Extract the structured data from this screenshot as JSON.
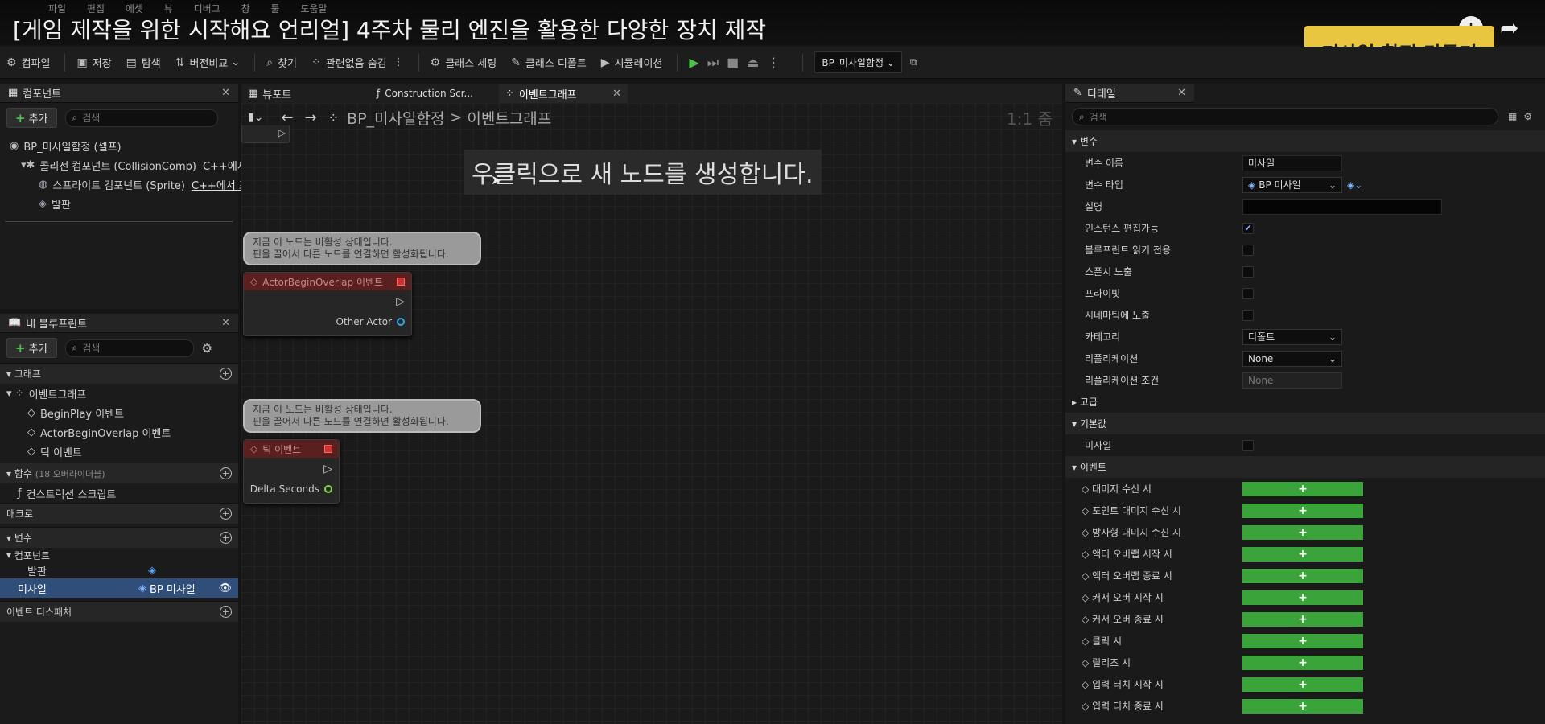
{
  "video": {
    "title": "[게임 제작을 위한 시작해요 언리얼] 4주차 물리 엔진을 활용한 다양한 장치 제작",
    "banner": "미사일 함정 만들기",
    "menu": [
      "파일",
      "편집",
      "에셋",
      "뷰",
      "디버그",
      "창",
      "툴",
      "도움말"
    ]
  },
  "toolbar": {
    "compile": "컴파일",
    "save": "저장",
    "browse": "탐색",
    "diff": "버전비교",
    "find": "찾기",
    "hide_unrelated": "관련없음 숨김",
    "class_settings": "클래스 세팅",
    "class_defaults": "클래스 디폴트",
    "simulation": "시뮬레이션",
    "bp_select": "BP_미사일함정"
  },
  "components_panel": {
    "tab": "컴포넌트",
    "add": "추가",
    "search_placeholder": "검색",
    "root": "BP_미사일함정 (셀프)",
    "items": [
      {
        "label": "콜리전 컴포넌트 (CollisionComp)",
        "note": "C++에서"
      },
      {
        "label": "스프라이트 컴포넌트 (Sprite)",
        "note": "C++에서 표"
      },
      {
        "label": "발판",
        "note": ""
      }
    ]
  },
  "my_blueprint": {
    "tab": "내 블루프린트",
    "add": "추가",
    "search_placeholder": "검색",
    "graph_header": "그래프",
    "event_graph": "이벤트그래프",
    "events": [
      "BeginPlay 이벤트",
      "ActorBeginOverlap 이벤트",
      "틱 이벤트"
    ],
    "functions_header": "함수",
    "functions_note": "(18 오버라이더블)",
    "construction_script": "컨스트럭션 스크립트",
    "macros_header": "매크로",
    "variables_header": "변수",
    "components_sub": "컴포넌트",
    "var_footplate": "발판",
    "var_selected": "미사일",
    "var_selected_type": "BP 미사일",
    "dispatchers_header": "이벤트 디스패처"
  },
  "graph": {
    "tabs": [
      "뷰포트",
      "Construction Scr...",
      "이벤트그래프"
    ],
    "breadcrumb_bp": "BP_미사일함정",
    "breadcrumb_sep": ">",
    "breadcrumb_graph": "이벤트그래프",
    "zoom": "1:1 줌",
    "hint": "우클릭으로 새 노드를 생성합니다.",
    "comment1_line1": "지금 이 노드는 비활성 상태입니다.",
    "comment1_line2": "핀을 끌어서 다른 노드를 연결하면 활성화됩니다.",
    "node1_title": "ActorBeginOverlap 이벤트",
    "node1_pin": "Other Actor",
    "comment2_line1": "지금 이 노드는 비활성 상태입니다.",
    "comment2_line2": "핀을 끌어서 다른 노드를 연결하면 활성화됩니다.",
    "node2_title": "틱 이벤트",
    "node2_pin": "Delta Seconds"
  },
  "details": {
    "tab": "디테일",
    "search_placeholder": "검색",
    "sec_variable": "변수",
    "var_name_label": "변수 이름",
    "var_name_value": "미사일",
    "var_type_label": "변수 타입",
    "var_type_value": "BP 미사일",
    "desc_label": "설명",
    "instance_editable": "인스턴스 편집가능",
    "bp_readonly": "블루프린트 읽기 전용",
    "expose_spawn": "스폰시 노출",
    "private": "프라이빗",
    "expose_cinematic": "시네마틱에 노출",
    "category_label": "카테고리",
    "category_value": "디폴트",
    "replication_label": "리플리케이션",
    "replication_value": "None",
    "rep_condition_label": "리플리케이션 조건",
    "rep_condition_value": "None",
    "sec_advanced": "고급",
    "sec_default": "기본값",
    "default_missile": "미사일",
    "sec_events": "이벤트",
    "events": [
      "대미지 수신 시",
      "포인트 대미지 수신 시",
      "방사형 대미지 수신 시",
      "액터 오버랩 시작 시",
      "액터 오버랩 종료 시",
      "커서 오버 시작 시",
      "커서 오버 종료 시",
      "클릭 시",
      "릴리즈 시",
      "입력 터치 시작 시",
      "입력 터치 종료 시"
    ],
    "plus": "+"
  }
}
